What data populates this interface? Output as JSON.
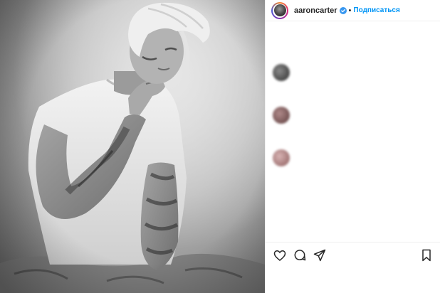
{
  "header": {
    "username": "aaroncarter",
    "separator": "•",
    "follow_label": "Подписаться"
  },
  "comments": [
    {
      "user": "",
      "text": "",
      "time": "",
      "reply": ""
    },
    {
      "user": "",
      "text": "",
      "time": "",
      "reply": ""
    },
    {
      "user": "",
      "text": "",
      "time": "",
      "reply": ""
    },
    {
      "user": "",
      "text": "",
      "time": "",
      "reply": ""
    }
  ],
  "likes": {
    "text": ""
  },
  "colors": {
    "link": "#0095f6",
    "verified": "#3897f0",
    "border": "#efefef"
  },
  "icons": {
    "verified": "verified-badge-icon",
    "like": "heart-icon",
    "comment": "comment-icon",
    "share": "share-icon",
    "save": "bookmark-icon"
  }
}
